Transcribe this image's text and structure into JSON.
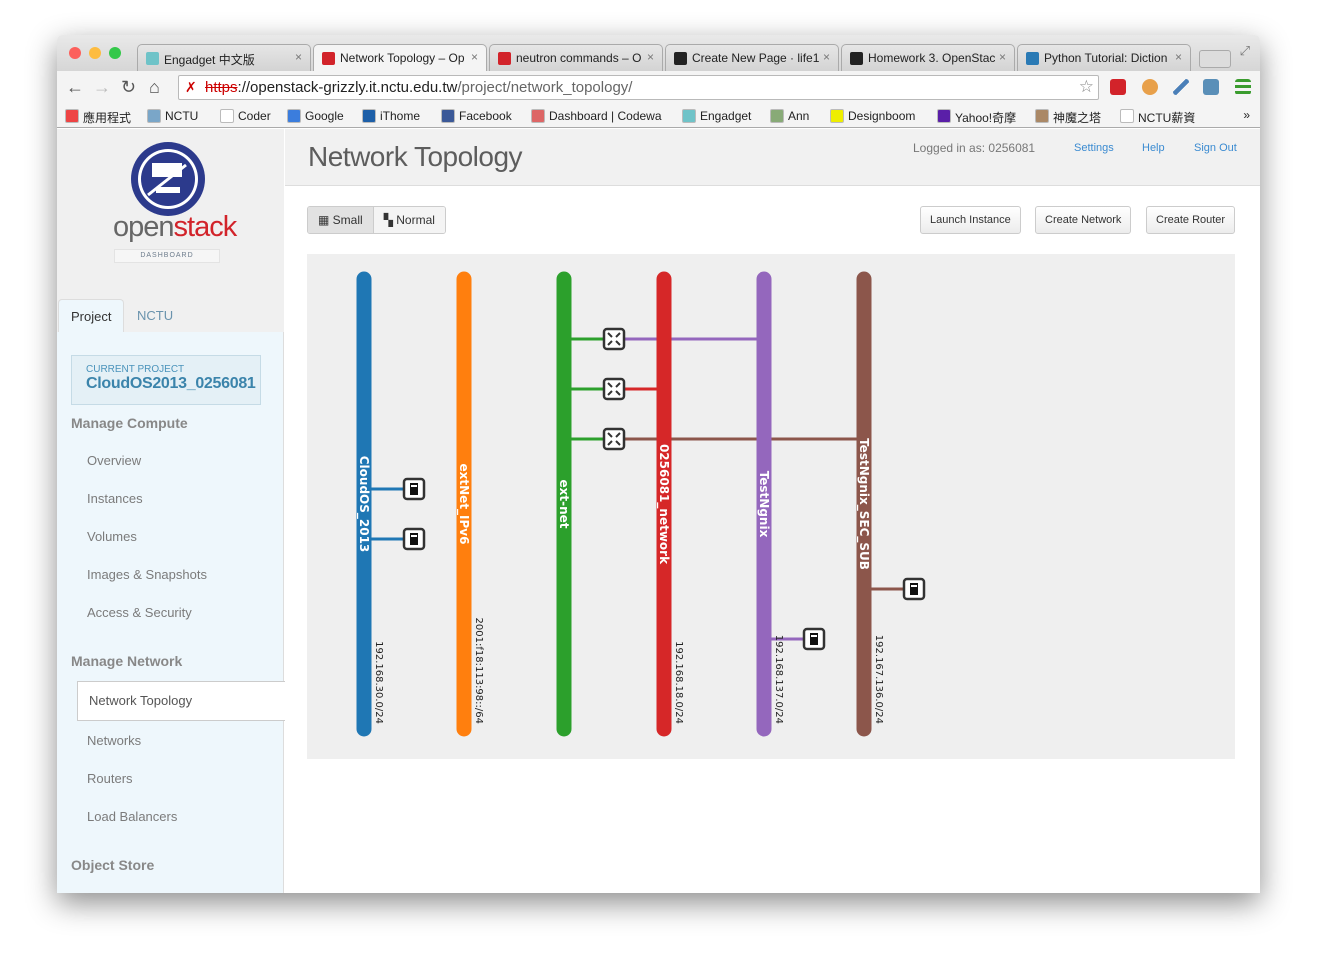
{
  "browser": {
    "tabs": [
      {
        "title": "Engadget 中文版",
        "icon_color": "#6fc3c8"
      },
      {
        "title": "Network Topology – Op",
        "icon_color": "#d2232a",
        "active": true
      },
      {
        "title": "neutron commands – O",
        "icon_color": "#d2232a"
      },
      {
        "title": "Create New Page · life1",
        "icon_color": "#222222"
      },
      {
        "title": "Homework 3. OpenStac",
        "icon_color": "#222222"
      },
      {
        "title": "Python Tutorial: Diction",
        "icon_color": "#2a7ab5"
      }
    ],
    "url_scheme": "https",
    "url_host": "://openstack-grizzly.it.nctu.edu.tw",
    "url_path": "/project/network_topology/",
    "bookmarks": [
      "應用程式",
      "NCTU",
      "Coder",
      "Google",
      "iThome",
      "Facebook",
      "Dashboard | Codewa",
      "Engadget",
      "Ann",
      "Designboom",
      "Yahoo!奇摩",
      "神魔之塔",
      "NCTU薪資"
    ],
    "bookmarks_more": "»"
  },
  "sidebar": {
    "logo_open": "open",
    "logo_stack": "stack",
    "logo_sub": "DASHBOARD",
    "tabs": [
      "Project",
      "NCTU"
    ],
    "current_project_label": "CURRENT PROJECT",
    "current_project": "CloudOS2013_0256081",
    "sections": [
      {
        "title": "Manage Compute",
        "items": [
          "Overview",
          "Instances",
          "Volumes",
          "Images & Snapshots",
          "Access & Security"
        ]
      },
      {
        "title": "Manage Network",
        "items": [
          "Network Topology",
          "Networks",
          "Routers",
          "Load Balancers"
        ]
      },
      {
        "title": "Object Store",
        "items": []
      }
    ],
    "active_item": "Network Topology"
  },
  "header": {
    "title": "Network Topology",
    "logged_in": "Logged in as: 0256081",
    "settings": "Settings",
    "help": "Help",
    "sign_out": "Sign Out"
  },
  "toolbar": {
    "view_small": "Small",
    "view_normal": "Normal",
    "selected_view": "Small",
    "launch_instance": "Launch Instance",
    "create_network": "Create Network",
    "create_router": "Create Router"
  },
  "topology": {
    "networks": [
      {
        "name": "CloudOS_2013",
        "cidr": "192.168.30.0/24",
        "color": "#1f77b4"
      },
      {
        "name": "extNet_IPv6",
        "cidr": "2001:f18:113:98::/64",
        "color": "#ff7f0e"
      },
      {
        "name": "ext-net",
        "cidr": "",
        "color": "#2ca02c"
      },
      {
        "name": "0256081_network",
        "cidr": "192.168.18.0/24",
        "color": "#d62728"
      },
      {
        "name": "TestNgnix",
        "cidr": "192.168.137.0/24",
        "color": "#9467bd"
      },
      {
        "name": "TestNgnix_SEC_SUB",
        "cidr": "192.167.136.0/24",
        "color": "#8c564b"
      }
    ],
    "routers": [
      {
        "gateway": "ext-net",
        "interface": "TestNgnix"
      },
      {
        "gateway": "ext-net",
        "interface": "0256081_network"
      },
      {
        "gateway": "ext-net",
        "interface": "TestNgnix_SEC_SUB"
      }
    ],
    "instances": [
      {
        "network": "CloudOS_2013"
      },
      {
        "network": "CloudOS_2013"
      },
      {
        "network": "TestNgnix_SEC_SUB"
      },
      {
        "network": "TestNgnix"
      }
    ]
  }
}
